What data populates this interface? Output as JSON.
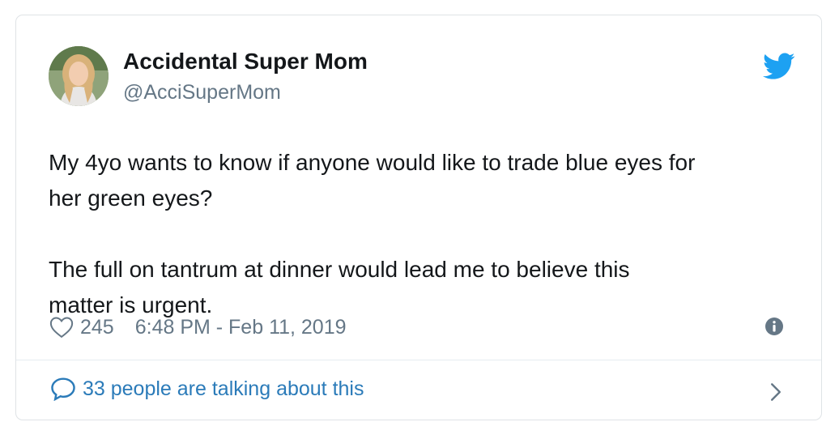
{
  "tweet": {
    "author": {
      "display_name": "Accidental Super Mom",
      "handle": "@AcciSuperMom"
    },
    "text_paragraphs": [
      "My 4yo wants to know if anyone would like to trade blue eyes for\nher green eyes?",
      "The full on tantrum at dinner would lead me to believe this\nmatter is urgent."
    ],
    "likes": "245",
    "timestamp": "6:48 PM - Feb 11, 2019",
    "conversation_label": "33 people are talking about this"
  },
  "icons": {
    "brand": "twitter-bird-icon",
    "like": "heart-icon",
    "info": "info-icon",
    "reply": "speech-bubble-icon",
    "more": "chevron-right-icon"
  },
  "colors": {
    "brand_blue": "#1da1f2",
    "link_blue": "#2b7bb9",
    "text_primary": "#14171a",
    "text_secondary": "#657786",
    "border": "#dfe3e6"
  }
}
